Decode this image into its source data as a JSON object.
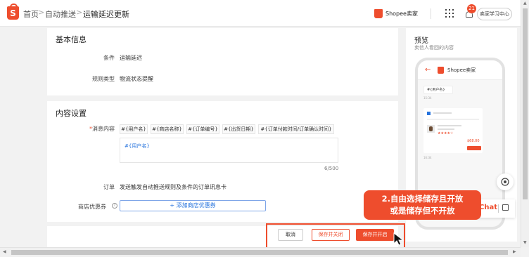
{
  "breadcrumb": {
    "home": "首页",
    "auto_push": "自动推送",
    "current": "运输延迟更新",
    "separator": ">"
  },
  "header": {
    "seller_name": "Shopee卖家",
    "notification_count": "21",
    "learning_center": "卖家学习中心"
  },
  "basic_info": {
    "title": "基本信息",
    "condition_label": "条件",
    "condition_value": "运输延迟",
    "rule_type_label": "规则类型",
    "rule_type_value": "物流状态提醒"
  },
  "content_settings": {
    "title": "内容设置",
    "message_label_required": "*",
    "message_label": "消息内容",
    "tags": [
      "#{用户名}",
      "#{商店名称}",
      "#{订单编号}",
      "#{出货日期}",
      "#{订单付款时间/订单确认时间}"
    ],
    "message_value": "#{用户名}",
    "char_counter": "6/500",
    "order_label": "订单",
    "order_value": "发送触发自动推送规则及条件的订单讯息卡",
    "coupon_label": "商店优惠券",
    "coupon_button": "+ 添加商店优惠券"
  },
  "footer": {
    "cancel": "取消",
    "save_close": "保存并关闭",
    "save_open": "保存并开启"
  },
  "preview": {
    "title": "预览",
    "subtitle": "卖信人看回的内容",
    "phone_shop_name": "Shopee卖家",
    "phone_bubble": "#{用户名}",
    "time_1": "15:34",
    "time_2": "16:34",
    "stars": "★★★★☆",
    "price": "$68.00"
  },
  "chat": {
    "label": "Chat"
  },
  "callout": {
    "line1": "2.自由选择储存且开放",
    "line2": "或是储存但不开放"
  },
  "colors": {
    "brand": "#ee4d2d",
    "link": "#2673dd"
  }
}
